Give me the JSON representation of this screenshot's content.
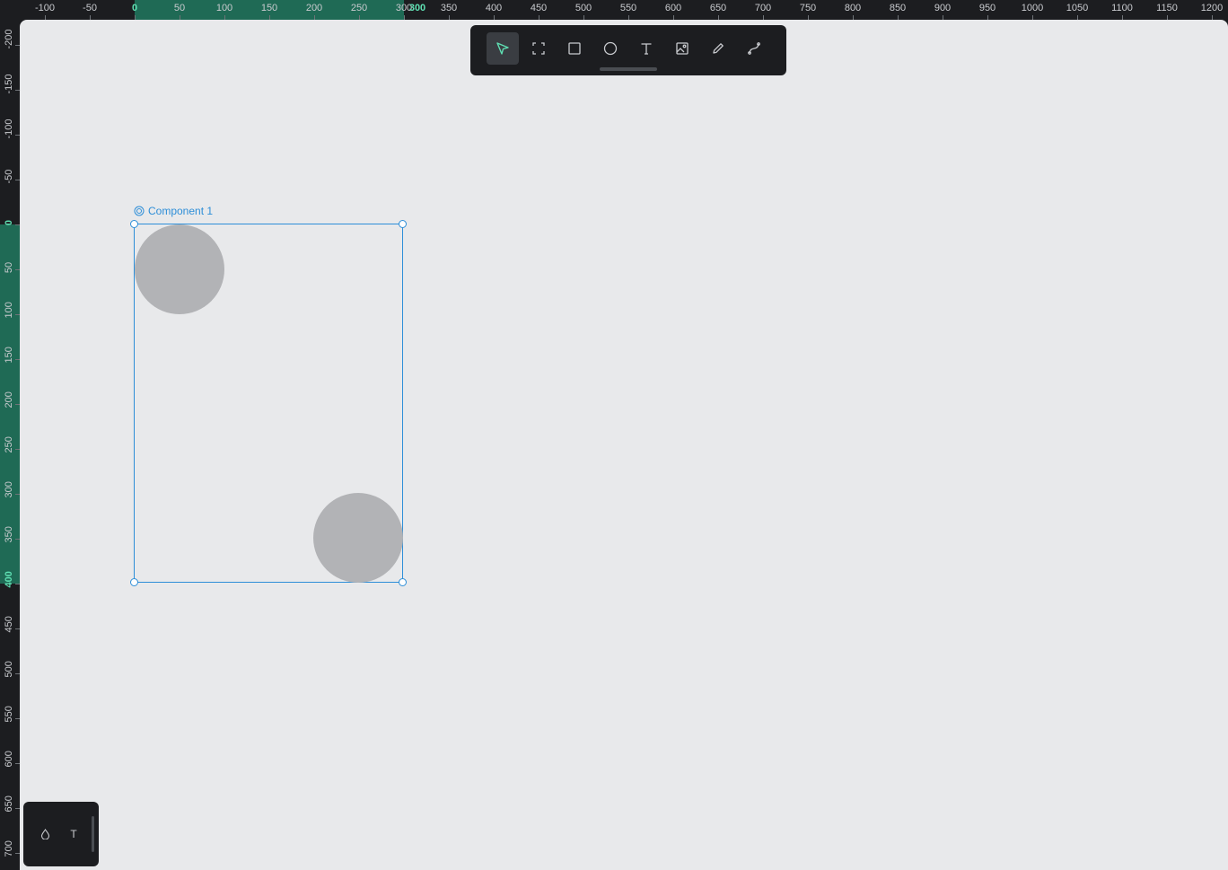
{
  "ruler": {
    "top_labels": [
      "-100",
      "-50",
      "0",
      "50",
      "100",
      "150",
      "200",
      "250",
      "300",
      "350",
      "400",
      "450",
      "500",
      "550",
      "600",
      "650",
      "700",
      "750",
      "800",
      "850",
      "900",
      "950",
      "1000",
      "1050",
      "1100",
      "1150",
      "1200"
    ],
    "left_labels": [
      "-200",
      "-150",
      "-100",
      "-50",
      "0",
      "50",
      "100",
      "150",
      "200",
      "250",
      "300",
      "350",
      "400",
      "450",
      "500",
      "550",
      "600",
      "650",
      "700"
    ],
    "selection_start": "0",
    "selection_end_x": "300",
    "selection_end_y": "400"
  },
  "toolbar": {
    "tools": [
      {
        "name": "select-tool",
        "icon": "pointer-icon",
        "active": true
      },
      {
        "name": "frame-tool",
        "icon": "frame-icon",
        "active": false
      },
      {
        "name": "rectangle-tool",
        "icon": "rectangle-icon",
        "active": false
      },
      {
        "name": "ellipse-tool",
        "icon": "ellipse-icon",
        "active": false
      },
      {
        "name": "text-tool",
        "icon": "text-icon",
        "active": false
      },
      {
        "name": "image-tool",
        "icon": "image-icon",
        "active": false
      },
      {
        "name": "pen-tool",
        "icon": "pencil-icon",
        "active": false
      },
      {
        "name": "path-tool",
        "icon": "curve-icon",
        "active": false
      }
    ]
  },
  "canvas": {
    "component_label": "Component 1"
  },
  "mini_panel": {
    "fill_icon": "drop-icon",
    "text_icon": "text-icon",
    "text_glyph": "T"
  },
  "colors": {
    "accent": "#5fe0b3",
    "selection": "#2d8ed8",
    "ruler_highlight": "#1f6a55",
    "canvas_bg": "#e8e9eb",
    "shape_fill": "#b2b3b6"
  }
}
